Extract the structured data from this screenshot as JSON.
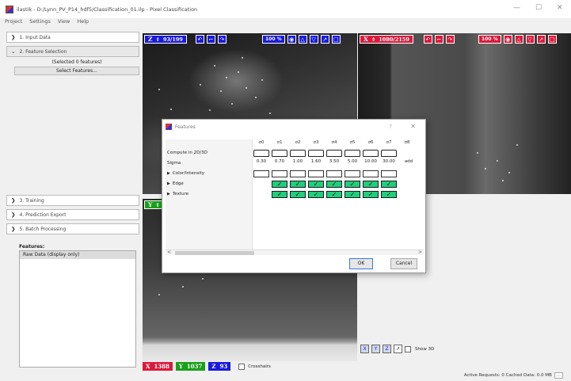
{
  "window": {
    "title": "ilastik - D:/Lynn_PV_P14_hdf5/Classification_01.ilp - Pixel Classification",
    "controls": {
      "minimize": "—",
      "maximize": "☐",
      "close": "✕"
    }
  },
  "menu": [
    "Project",
    "Settings",
    "View",
    "Help"
  ],
  "left": {
    "applets": [
      {
        "label": "1. Input Data",
        "state": "closed"
      },
      {
        "label": "2. Feature Selection",
        "state": "open"
      },
      {
        "label": "3. Training",
        "state": "closed"
      },
      {
        "label": "4. Prediction Export",
        "state": "closed"
      },
      {
        "label": "5. Batch Processing",
        "state": "closed"
      }
    ],
    "selected_count": "(Selected 0 features)",
    "select_features_button": "Select Features...",
    "features_title": "Features:",
    "features_items": [
      "Raw Data (display only)"
    ]
  },
  "viewers": {
    "z": {
      "axis": "Z",
      "slice": "93/199",
      "zoom": "100 %"
    },
    "x": {
      "axis": "X",
      "slice": "1080/2159",
      "zoom": "100 %"
    },
    "y": {
      "axis": "Y"
    }
  },
  "bottom": {
    "x_label": "X",
    "x_value": "1388",
    "y_label": "Y",
    "y_value": "1037",
    "z_label": "Z",
    "z_value": "93",
    "crosshairs": "Crosshairs",
    "show3d": "Show 3D",
    "status": "Active Requests: 0  Cached Data: 0.0 MB",
    "more": "..."
  },
  "dialog": {
    "title": "Features",
    "help": "?",
    "close": "✕",
    "columns": [
      "σ0",
      "σ1",
      "σ2",
      "σ3",
      "σ4",
      "σ5",
      "σ6",
      "σ7",
      "σ8"
    ],
    "sigma_values": [
      "0.30",
      "0.70",
      "1.00",
      "1.60",
      "3.50",
      "5.00",
      "10.00",
      "30.00",
      "add"
    ],
    "rows": {
      "compute": "Compute in 2D/3D",
      "sigma": "Sigma",
      "color": "Color/Intensity",
      "edge": "Edge",
      "texture": "Texture"
    },
    "scroll_left": "<",
    "scroll_right": ">",
    "ok": "OK",
    "cancel": "Cancel"
  },
  "colors": {
    "blue": "#1a1adc",
    "red": "#dc1a3c",
    "green": "#1aa01a",
    "checked": "#1ecf7c"
  }
}
